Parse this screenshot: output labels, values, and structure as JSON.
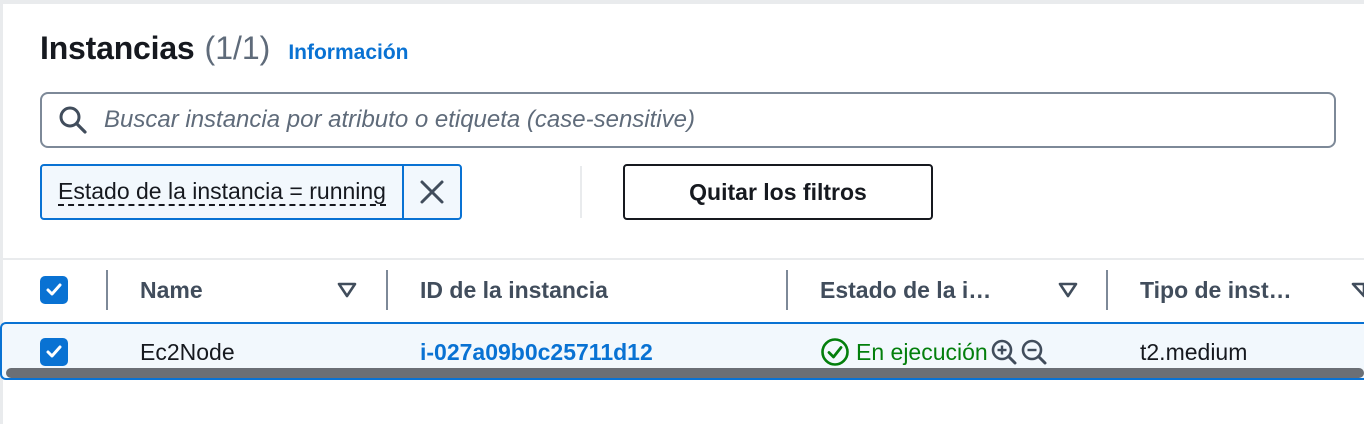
{
  "header": {
    "title": "Instancias",
    "count": "(1/1)",
    "info_link": "Información"
  },
  "search": {
    "placeholder": "Buscar instancia por atributo o etiqueta (case-sensitive)",
    "icon": "search-icon"
  },
  "filters": {
    "token_label": "Estado de la instancia = running",
    "remove_icon": "close-icon",
    "clear_label": "Quitar los filtros"
  },
  "table": {
    "columns": [
      {
        "label": "Name",
        "sortable": true
      },
      {
        "label": "ID de la instancia",
        "sortable": false
      },
      {
        "label": "Estado de la i…",
        "sortable": true
      },
      {
        "label": "Tipo de inst…",
        "sortable": true
      }
    ],
    "rows": [
      {
        "selected": true,
        "name": "Ec2Node",
        "instance_id": "i-027a09b0c25711d12",
        "state": "En ejecución",
        "type": "t2.medium"
      }
    ]
  },
  "colors": {
    "link": "#0972d3",
    "success": "#037f0c",
    "selected_bg": "#f2f8fd",
    "text": "#16191f"
  }
}
